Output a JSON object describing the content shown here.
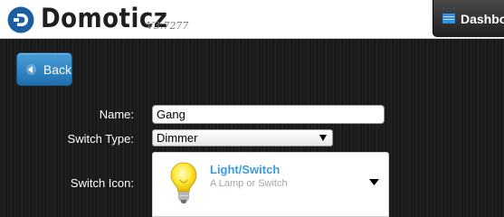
{
  "header": {
    "brand": "Domoticz",
    "version": "V3.7277",
    "dashboard_label": "Dashbo",
    "brand_color": "#1a5fa0"
  },
  "back_button": {
    "label": "Back"
  },
  "form": {
    "name": {
      "label": "Name:",
      "value": "Gang"
    },
    "switch_type": {
      "label": "Switch Type:",
      "value": "Dimmer"
    },
    "switch_icon": {
      "label": "Switch Icon:",
      "title": "Light/Switch",
      "description": "A Lamp or Switch",
      "icon": "lightbulb-icon"
    }
  },
  "colors": {
    "accent": "#3d9be0",
    "back_button": "#2b7fc1"
  }
}
